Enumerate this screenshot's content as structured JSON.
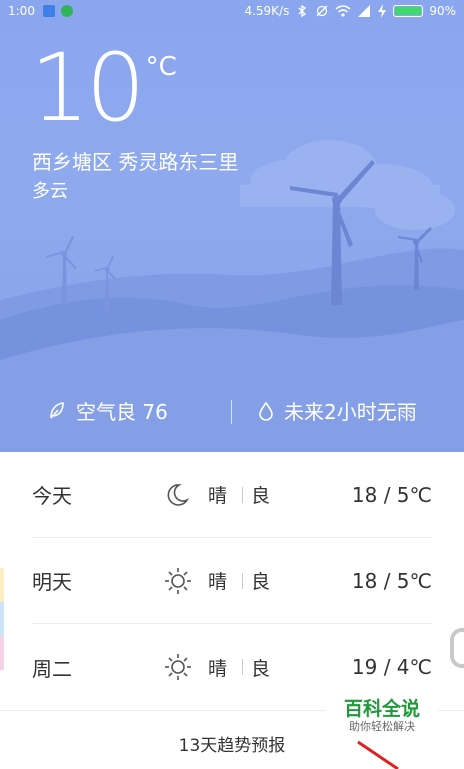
{
  "status_bar": {
    "time": "1:00",
    "network_speed": "4.59K/s",
    "battery_percent": "90%",
    "battery_level": 0.9,
    "icons": [
      "app-icon-blue",
      "app-icon-green",
      "bluetooth-icon",
      "sync-icon",
      "wifi-icon",
      "signal-icon",
      "charging-icon",
      "battery-icon"
    ]
  },
  "weather": {
    "temperature": "10",
    "unit": "°C",
    "location": "西乡塘区 秀灵路东三里",
    "condition": "多云",
    "air_quality": "空气良 76",
    "rain_forecast": "未来2小时无雨"
  },
  "forecast": [
    {
      "day": "今天",
      "icon": "moon-icon",
      "weather": "晴",
      "quality": "良",
      "temp": "18 / 5℃"
    },
    {
      "day": "明天",
      "icon": "sun-icon",
      "weather": "晴",
      "quality": "良",
      "temp": "18 / 5℃"
    },
    {
      "day": "周二",
      "icon": "sun-icon",
      "weather": "晴",
      "quality": "良",
      "temp": "19 / 4℃"
    }
  ],
  "trend_button": "13天趋势预报",
  "watermark": {
    "title": "百科全说",
    "subtitle": "助你轻松解决"
  },
  "colors": {
    "hero_bg": "#8aa6ef",
    "battery_fill": "#3fd86b",
    "watermark_green": "#1f9a3a"
  }
}
